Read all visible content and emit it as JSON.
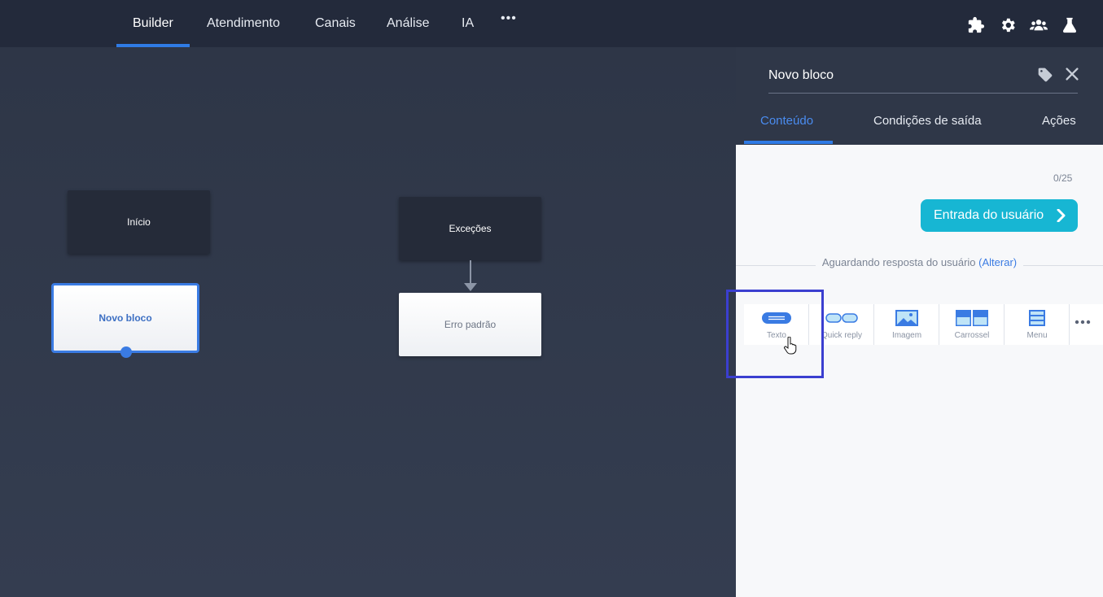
{
  "nav": {
    "tabs": [
      {
        "label": "Builder",
        "active": true
      },
      {
        "label": "Atendimento"
      },
      {
        "label": "Canais"
      },
      {
        "label": "Análise"
      },
      {
        "label": "IA"
      }
    ],
    "more": "•••",
    "icons": [
      "puzzle-icon",
      "gear-icon",
      "users-icon",
      "flask-icon"
    ]
  },
  "canvas": {
    "nodes": {
      "inicio": "Início",
      "novo_bloco": "Novo bloco",
      "excecoes": "Exceções",
      "erro_padrao": "Erro padrão"
    }
  },
  "panel": {
    "block_name": "Novo bloco",
    "tabs": [
      {
        "label": "Conteúdo",
        "active": true
      },
      {
        "label": "Condições de saída"
      },
      {
        "label": "Ações"
      }
    ],
    "counter": "0/25",
    "entrada_button": "Entrada do usuário",
    "waiting_text": "Aguardando resposta do usuário",
    "alterar_link": "(Alterar)",
    "tools": [
      {
        "label": "Texto",
        "icon": "text-icon"
      },
      {
        "label": "Quick reply",
        "icon": "quick-reply-icon"
      },
      {
        "label": "Imagem",
        "icon": "image-icon"
      },
      {
        "label": "Carrossel",
        "icon": "carousel-icon"
      },
      {
        "label": "Menu",
        "icon": "menu-icon"
      }
    ],
    "more_tools": "•••"
  },
  "colors": {
    "accent": "#2f7be5",
    "entrada": "#17b6d3",
    "highlight": "#3b3fd0"
  }
}
